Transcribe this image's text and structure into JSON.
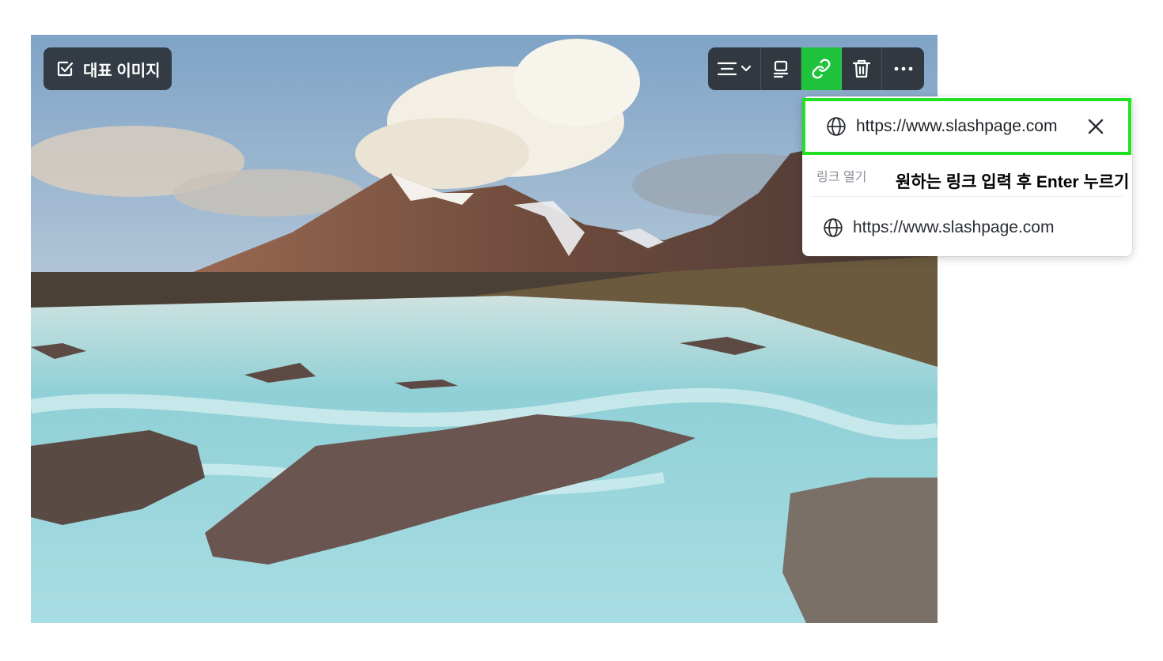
{
  "cover_badge": {
    "label": "대표 이미지",
    "icon": "checkbox-checked-icon"
  },
  "toolbar": {
    "buttons": [
      {
        "name": "align",
        "icon": "align-center-icon"
      },
      {
        "name": "caption",
        "icon": "caption-icon"
      },
      {
        "name": "link",
        "icon": "link-icon",
        "active": true
      },
      {
        "name": "delete",
        "icon": "trash-icon"
      },
      {
        "name": "more",
        "icon": "more-horizontal-icon"
      }
    ],
    "active_color": "#1fc23b"
  },
  "link_popup": {
    "input_value": "https://www.slashpage.com",
    "section_label": "링크 열기",
    "suggestion": "https://www.slashpage.com"
  },
  "annotation": {
    "text": "원하는 링크 입력 후 Enter 누르기",
    "highlight_color": "#22e024"
  }
}
